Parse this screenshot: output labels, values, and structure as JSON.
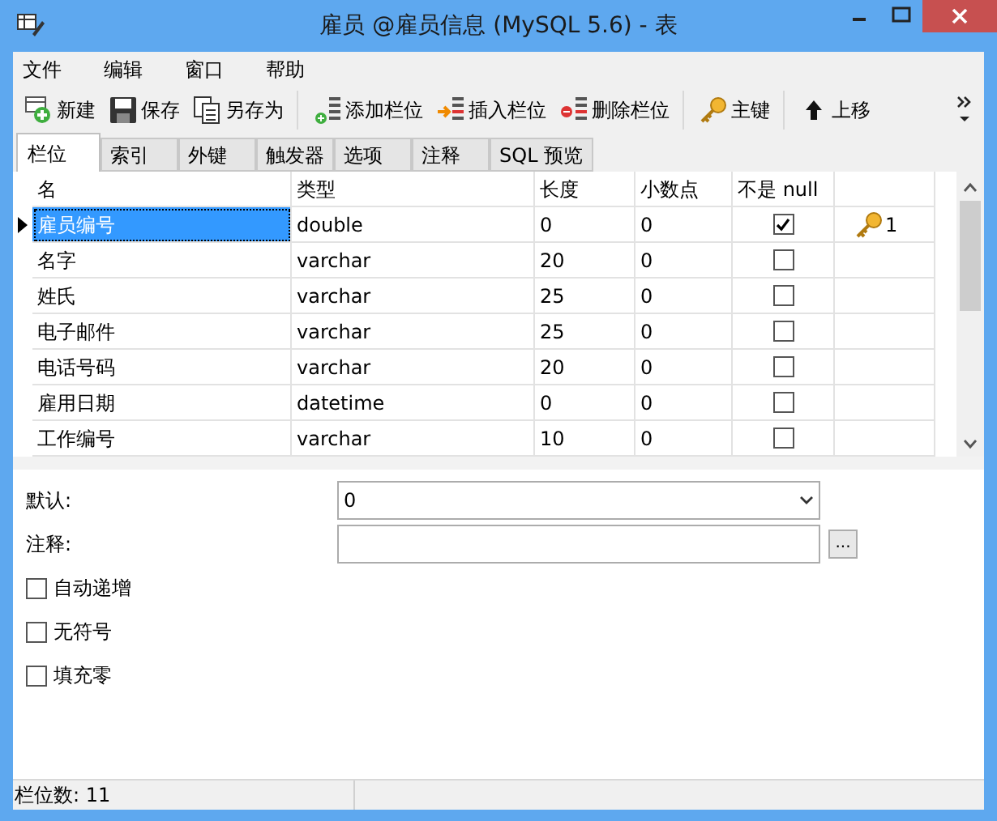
{
  "window": {
    "title": "雇员 @雇员信息 (MySQL 5.6) - 表"
  },
  "menu": [
    "文件",
    "编辑",
    "窗口",
    "帮助"
  ],
  "toolbar": [
    [
      {
        "kind": "new",
        "label": "新建"
      },
      {
        "kind": "save",
        "label": "保存"
      },
      {
        "kind": "saveas",
        "label": "另存为"
      }
    ],
    [
      {
        "kind": "add",
        "label": "添加栏位"
      },
      {
        "kind": "insert",
        "label": "插入栏位"
      },
      {
        "kind": "delete",
        "label": "删除栏位"
      }
    ],
    [
      {
        "kind": "key",
        "label": "主键"
      }
    ],
    [
      {
        "kind": "up",
        "label": "上移"
      }
    ]
  ],
  "tabs": [
    {
      "label": "栏位",
      "selected": true
    },
    {
      "label": "索引",
      "selected": false
    },
    {
      "label": "外键",
      "selected": false
    },
    {
      "label": "触发器",
      "selected": false
    },
    {
      "label": "选项",
      "selected": false
    },
    {
      "label": "注释",
      "selected": false
    },
    {
      "label": "SQL 预览",
      "selected": false
    }
  ],
  "table": {
    "columns": [
      "名",
      "类型",
      "长度",
      "小数点",
      "不是 null"
    ],
    "rows": [
      {
        "name": "雇员编号",
        "type": "double",
        "length": "0",
        "decimals": "0",
        "not_null": true,
        "key": "1",
        "selected": true
      },
      {
        "name": "名字",
        "type": "varchar",
        "length": "20",
        "decimals": "0",
        "not_null": false,
        "selected": false
      },
      {
        "name": "姓氏",
        "type": "varchar",
        "length": "25",
        "decimals": "0",
        "not_null": false,
        "selected": false
      },
      {
        "name": "电子邮件",
        "type": "varchar",
        "length": "25",
        "decimals": "0",
        "not_null": false,
        "selected": false
      },
      {
        "name": "电话号码",
        "type": "varchar",
        "length": "20",
        "decimals": "0",
        "not_null": false,
        "selected": false
      },
      {
        "name": "雇用日期",
        "type": "datetime",
        "length": "0",
        "decimals": "0",
        "not_null": false,
        "selected": false
      },
      {
        "name": "工作编号",
        "type": "varchar",
        "length": "10",
        "decimals": "0",
        "not_null": false,
        "selected": false
      }
    ]
  },
  "properties": {
    "default_label": "默认:",
    "default_value": "0",
    "comment_label": "注释:",
    "comment_button": "...",
    "options": [
      {
        "label": "自动递增",
        "checked": false
      },
      {
        "label": "无符号",
        "checked": false
      },
      {
        "label": "填充零",
        "checked": false
      }
    ]
  },
  "status_bar": {
    "text": "栏位数: 11"
  }
}
